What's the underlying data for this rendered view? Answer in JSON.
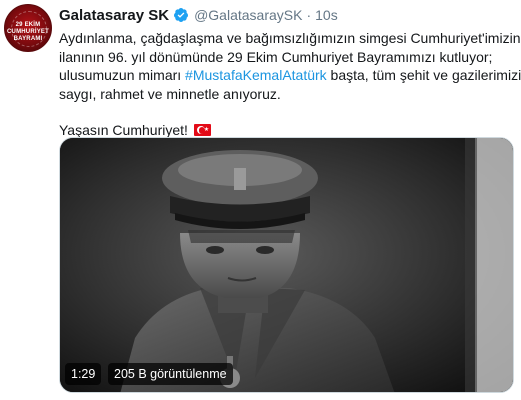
{
  "account": {
    "display_name": "Galatasaray SK",
    "handle": "@GalatasaraySK",
    "separator": "·",
    "time": "10s",
    "verified_color": "#1da1f2",
    "avatar_text": "29 EKİM CUMHURİYET BAYRAMI"
  },
  "tweet": {
    "line1": "Aydınlanma, çağdaşlaşma ve bağımsızlığımızın simgesi Cumhuriyet'imizin",
    "line2": "ilanının 96. yıl dönümünde 29 Ekim Cumhuriyet Bayramımızı kutluyor;",
    "line3_before": "ulusumuzun mimarı ",
    "hashtag": "#MustafaKemalAtatürk",
    "line3_after": " başta, tüm şehit ve gazilerimizi",
    "line4": "saygı, rahmet ve minnetle anıyoruz.",
    "closing": "Yaşasın Cumhuriyet!",
    "flag_icon": "turkey-flag-icon",
    "hashtag_color": "#1b95e0"
  },
  "video": {
    "duration": "1:29",
    "views": "205 B görüntülenme"
  }
}
